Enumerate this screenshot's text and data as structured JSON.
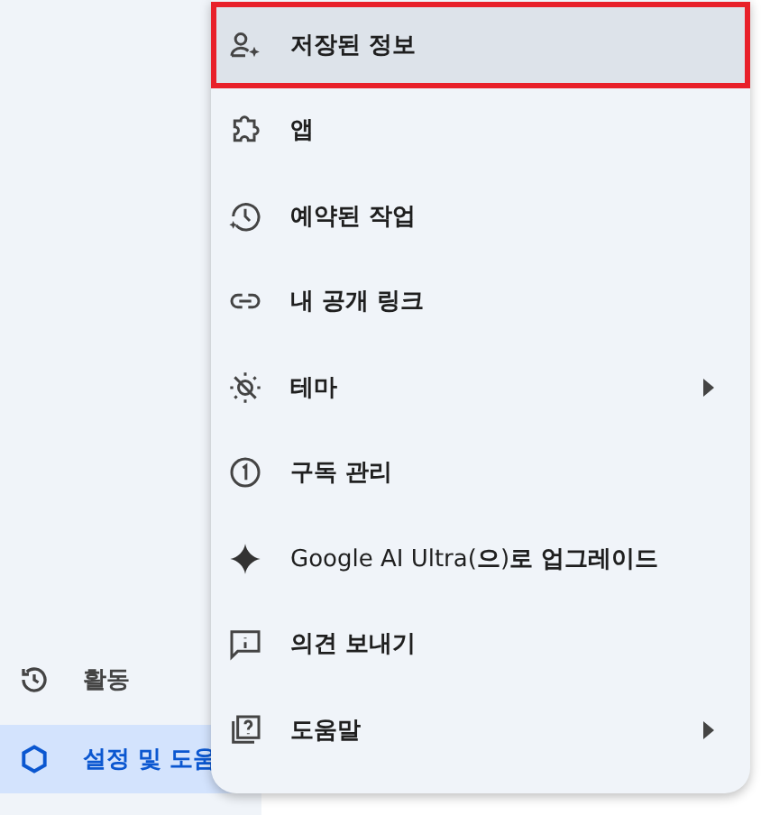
{
  "sidebar": {
    "items": [
      {
        "label": "활동",
        "selected": false
      },
      {
        "label": "설정 및 도움",
        "selected": true
      }
    ]
  },
  "menu": {
    "items": [
      {
        "label": "저장된 정보",
        "kind": "entry",
        "selected": true,
        "outlined": true,
        "submenu": false
      },
      {
        "label": "앱",
        "kind": "entry",
        "selected": false,
        "outlined": false,
        "submenu": false
      },
      {
        "label": "예약된 작업",
        "kind": "entry",
        "selected": false,
        "outlined": false,
        "submenu": false
      },
      {
        "label": "내 공개 링크",
        "kind": "entry",
        "selected": false,
        "outlined": false,
        "submenu": false
      },
      {
        "label": "테마",
        "kind": "entry",
        "selected": false,
        "outlined": false,
        "submenu": true
      },
      {
        "label": "구독 관리",
        "kind": "entry",
        "selected": false,
        "outlined": false,
        "submenu": false
      },
      {
        "label": "Google AI Ultra(**으**)**로 업그레이드**",
        "kind": "promo",
        "selected": false,
        "outlined": false,
        "submenu": false
      },
      {
        "label": "의견 보내기",
        "kind": "entry",
        "selected": false,
        "outlined": false,
        "submenu": false
      },
      {
        "label": "도움말",
        "kind": "entry",
        "selected": false,
        "outlined": false,
        "submenu": true
      }
    ]
  }
}
